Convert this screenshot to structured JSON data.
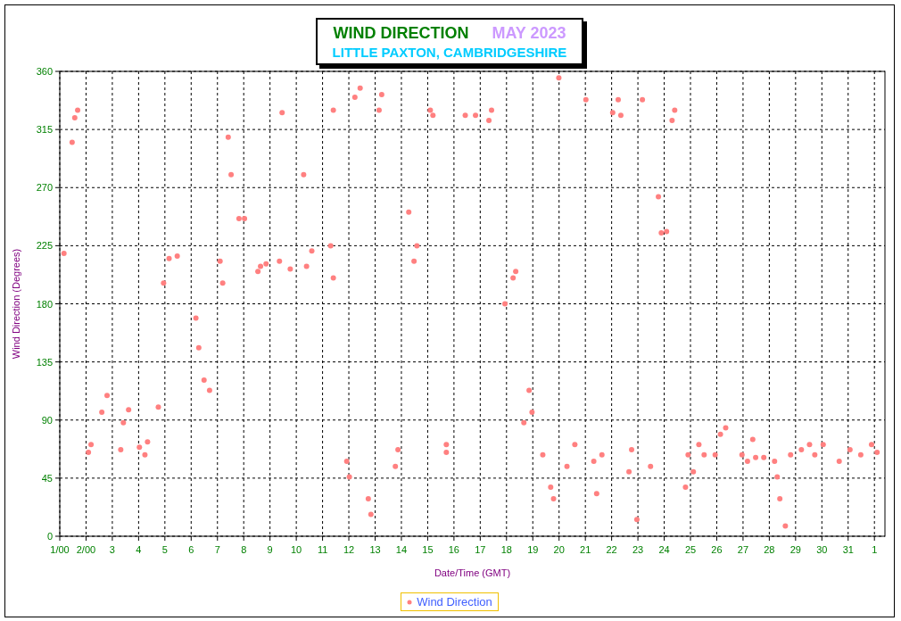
{
  "next_month_start_label": "1",
  "title": {
    "main": "WIND DIRECTION",
    "period": "MAY 2023",
    "location": "LITTLE PAXTON, CAMBRIDGESHIRE"
  },
  "chart_data": {
    "type": "scatter",
    "xlabel": "Date/Time (GMT)",
    "ylabel": "Wind Direction (Degrees)",
    "xlim": [
      1,
      32.4
    ],
    "ylim": [
      0,
      360
    ],
    "xticks": [
      {
        "value": 1,
        "label": "1/00"
      },
      {
        "value": 2,
        "label": "2/00"
      },
      3,
      4,
      5,
      6,
      7,
      8,
      9,
      10,
      11,
      12,
      13,
      14,
      15,
      16,
      17,
      18,
      19,
      20,
      21,
      22,
      23,
      24,
      25,
      26,
      27,
      28,
      29,
      30,
      31
    ],
    "grid": true,
    "yticks": [
      0,
      45,
      90,
      135,
      180,
      225,
      270,
      315,
      360
    ],
    "x": [
      1.16,
      1.47,
      1.57,
      1.68,
      2.09,
      2.19,
      2.6,
      2.8,
      3.32,
      3.42,
      3.62,
      4.03,
      4.24,
      4.34,
      4.75,
      4.95,
      5.16,
      5.47,
      6.18,
      6.29,
      6.49,
      6.7,
      7.1,
      7.2,
      7.41,
      7.52,
      7.82,
      8.03,
      8.54,
      8.64,
      8.85,
      9.36,
      9.46,
      9.77,
      10.28,
      10.39,
      10.59,
      11.31,
      11.41,
      11.41,
      11.92,
      12.02,
      12.23,
      12.43,
      12.74,
      12.84,
      13.15,
      13.25,
      13.77,
      13.87,
      14.28,
      14.48,
      14.59,
      15.1,
      15.2,
      15.71,
      15.71,
      16.43,
      16.82,
      17.33,
      17.43,
      17.94,
      18.25,
      18.35,
      18.66,
      18.86,
      18.97,
      19.38,
      19.68,
      19.79,
      19.99,
      20.3,
      20.6,
      21.02,
      21.32,
      21.43,
      21.63,
      22.04,
      22.25,
      22.35,
      22.66,
      22.76,
      22.96,
      23.17,
      23.48,
      23.78,
      23.89,
      24.09,
      24.3,
      24.4,
      24.81,
      24.91,
      25.11,
      25.32,
      25.52,
      25.94,
      26.14,
      26.34,
      26.96,
      27.17,
      27.37,
      27.48,
      27.79,
      28.2,
      28.3,
      28.4,
      28.61,
      28.81,
      29.22,
      29.53,
      29.73,
      30.05,
      30.66,
      31.07,
      31.48,
      31.89,
      32.1
    ],
    "series": [
      {
        "name": "Wind Direction",
        "color": "#ff8080",
        "values": [
          219,
          305,
          324,
          330,
          65,
          71,
          96,
          109,
          67,
          88,
          98,
          69,
          63,
          73,
          100,
          196,
          215,
          217,
          169,
          146,
          121,
          113,
          213,
          196,
          309,
          280,
          246,
          246,
          205,
          209,
          211,
          213,
          328,
          207,
          280,
          209,
          221,
          225,
          200,
          330,
          58,
          46,
          340,
          347,
          29,
          17,
          330,
          342,
          54,
          67,
          251,
          213,
          225,
          330,
          326,
          71,
          65,
          326,
          326,
          322,
          330,
          180,
          200,
          205,
          88,
          113,
          96,
          63,
          38,
          29,
          355,
          54,
          71,
          338,
          58,
          33,
          63,
          328,
          338,
          326,
          50,
          67,
          13,
          338,
          54,
          263,
          235,
          236,
          322,
          330,
          38,
          63,
          50,
          71,
          63,
          63,
          79,
          84,
          63,
          58,
          75,
          61,
          61,
          58,
          46,
          29,
          8,
          63,
          67,
          71,
          63,
          71,
          58,
          67,
          63,
          71,
          65
        ]
      }
    ]
  }
}
